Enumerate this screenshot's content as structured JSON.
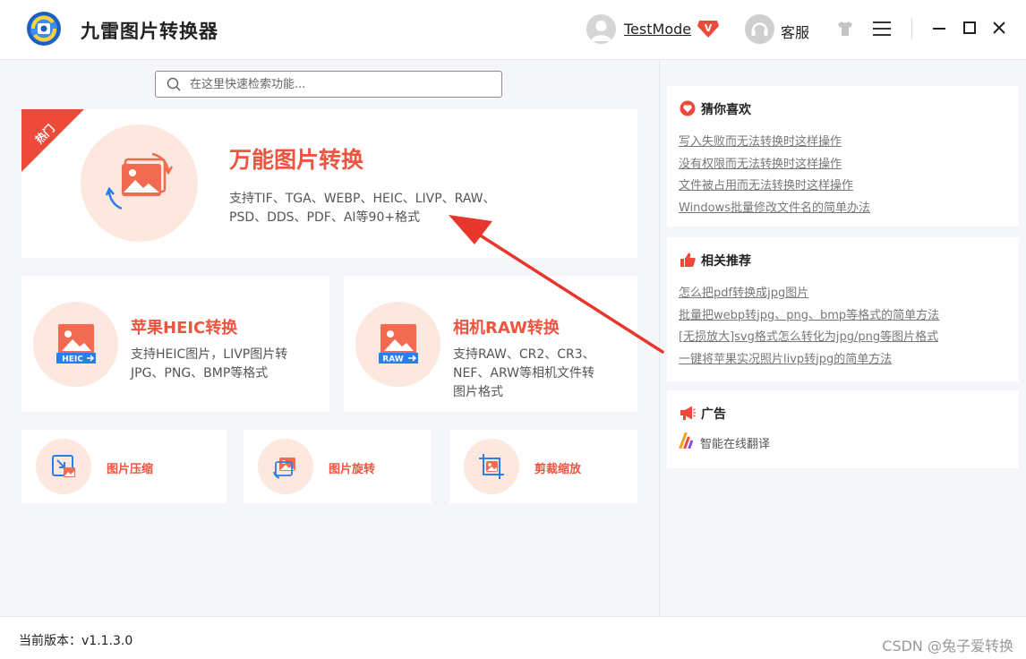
{
  "header": {
    "app_title": "九雷图片转换器",
    "user_name": "TestMode",
    "vip_badge": "V",
    "service_label": "客服"
  },
  "search": {
    "placeholder": "在这里快速检索功能...",
    "value": ""
  },
  "hero": {
    "badge": "热门",
    "title": "万能图片转换",
    "desc_line1": "支持TIF、TGA、WEBP、HEIC、LIVP、RAW、",
    "desc_line2": "PSD、DDS、PDF、AI等90+格式"
  },
  "features": [
    {
      "title": "苹果HEIC转换",
      "icon_label": "HEIC",
      "desc_line1": "支持HEIC图片，LIVP图片转",
      "desc_line2": "JPG、PNG、BMP等格式"
    },
    {
      "title": "相机RAW转换",
      "icon_label": "RAW",
      "desc_line1": "支持RAW、CR2、CR3、",
      "desc_line2": "NEF、ARW等相机文件转",
      "desc_line3": "图片格式"
    }
  ],
  "tools": [
    {
      "label": "图片压缩"
    },
    {
      "label": "图片旋转"
    },
    {
      "label": "剪裁缩放"
    }
  ],
  "sidebar": {
    "like": {
      "title": "猜你喜欢",
      "links": [
        "写入失败而无法转换时这样操作",
        "没有权限而无法转换时这样操作",
        "文件被占用而无法转换时这样操作",
        "Windows批量修改文件名的简单办法"
      ]
    },
    "recommend": {
      "title": "相关推荐",
      "links": [
        "怎么把pdf转换成jpg图片",
        "批量把webp转jpg、png、bmp等格式的简单方法",
        "[无损放大]svg格式怎么转化为jpg/png等图片格式",
        "一键将苹果实况照片livp转jpg的简单方法"
      ]
    },
    "ad": {
      "title": "广告",
      "item": "智能在线翻译"
    }
  },
  "footer": {
    "version_label": "当前版本：v1.1.3.0",
    "watermark": "CSDN @兔子爱转换"
  },
  "colors": {
    "accent": "#ee5540",
    "icon_bg": "#fde8df",
    "arrow": "#e8362c"
  }
}
